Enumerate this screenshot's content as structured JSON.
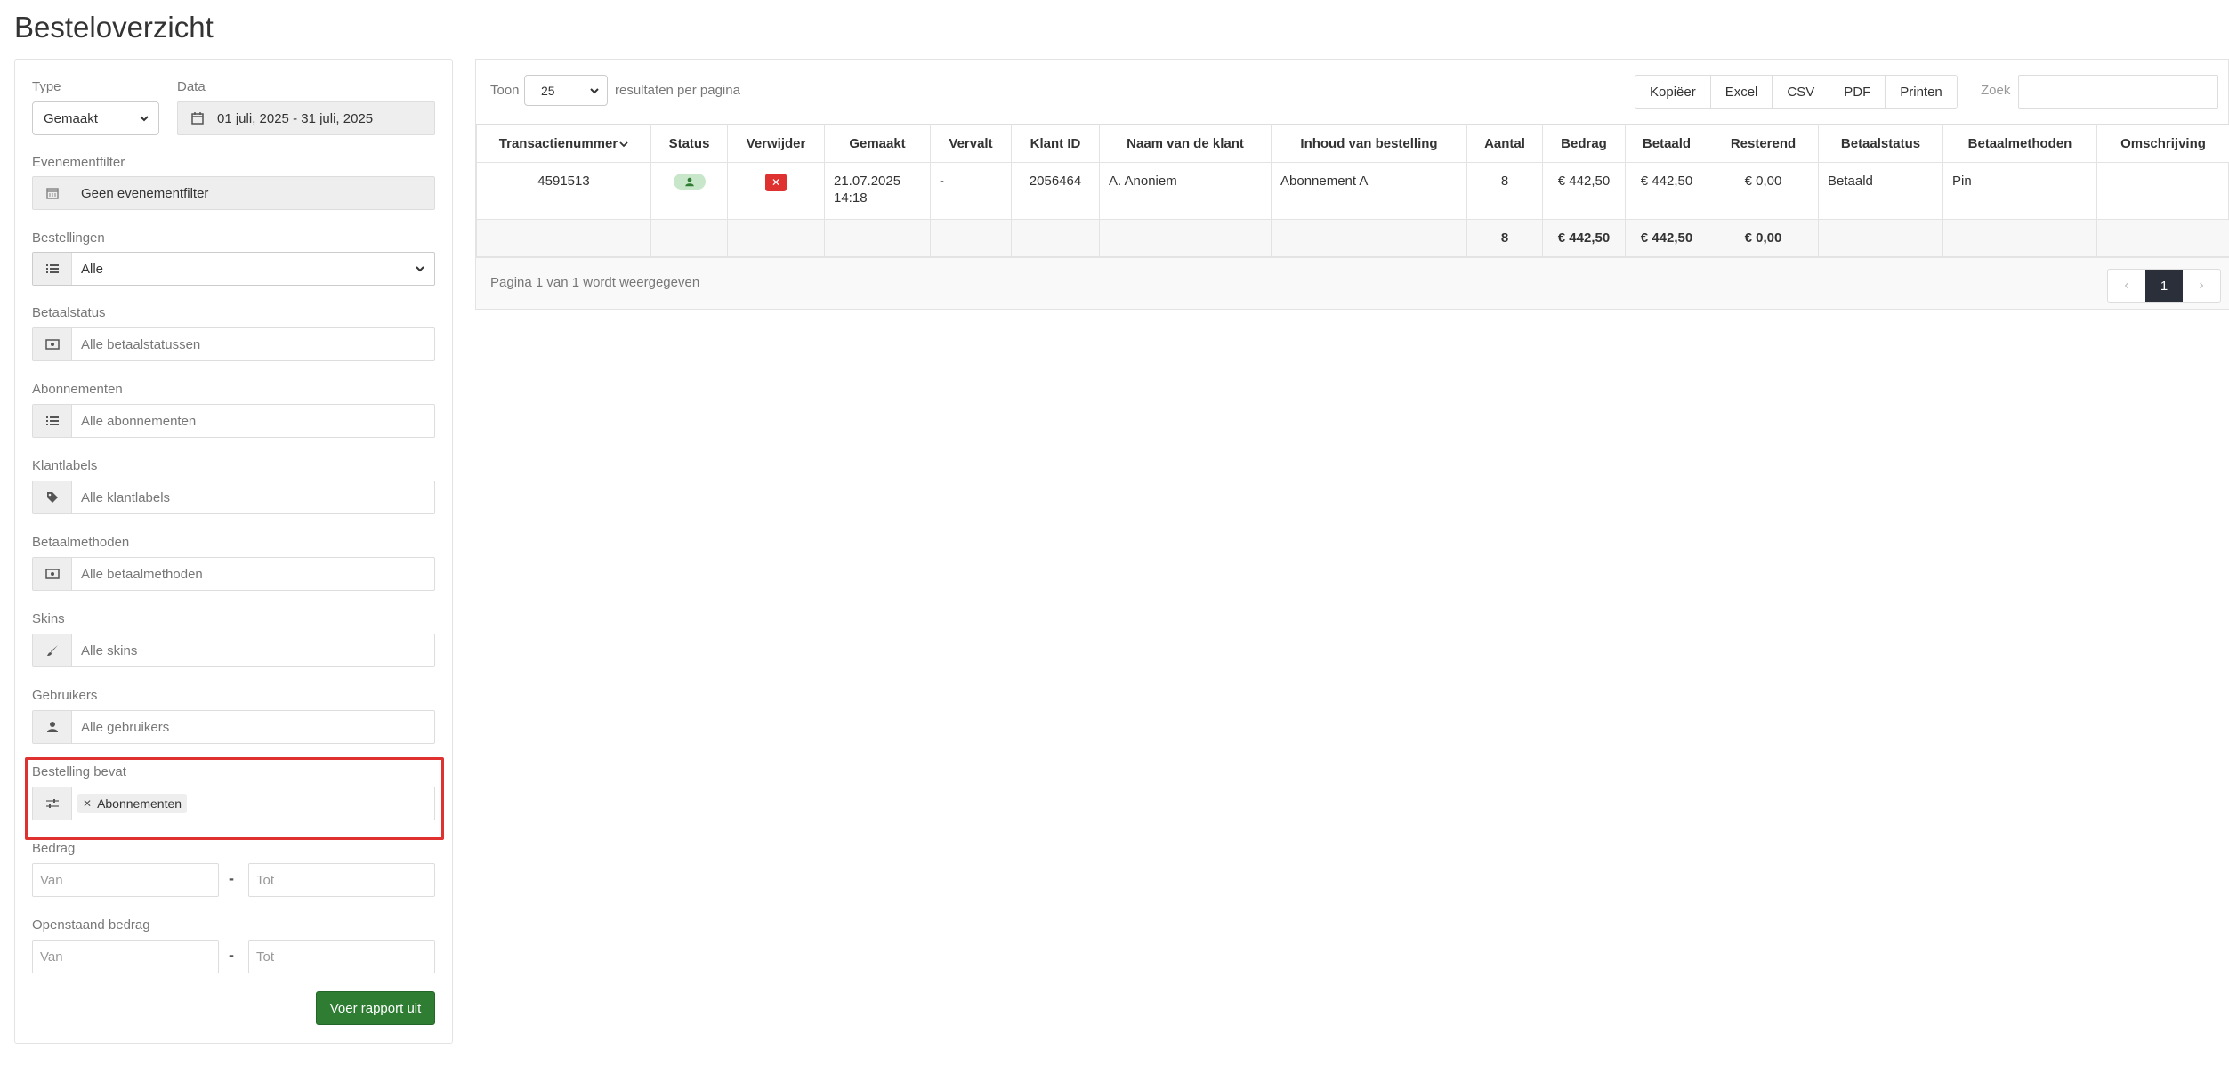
{
  "page": {
    "title": "Besteloverzicht"
  },
  "filters": {
    "type_label": "Type",
    "type_value": "Gemaakt",
    "data_label": "Data",
    "date_range": "01 juli, 2025 - 31 juli, 2025",
    "event_label": "Evenementfilter",
    "event_value": "Geen evenementfilter",
    "orders_label": "Bestellingen",
    "orders_value": "Alle",
    "paystatus_label": "Betaalstatus",
    "paystatus_placeholder": "Alle betaalstatussen",
    "subscriptions_label": "Abonnementen",
    "subscriptions_placeholder": "Alle abonnementen",
    "customer_labels_label": "Klantlabels",
    "customer_labels_placeholder": "Alle klantlabels",
    "paymethods_label": "Betaalmethoden",
    "paymethods_placeholder": "Alle betaalmethoden",
    "skins_label": "Skins",
    "skins_placeholder": "Alle skins",
    "users_label": "Gebruikers",
    "users_placeholder": "Alle gebruikers",
    "order_contains_label": "Bestelling bevat",
    "order_contains_tag": "Abonnementen",
    "amount_label": "Bedrag",
    "outstanding_label": "Openstaand bedrag",
    "from_placeholder": "Van",
    "to_placeholder": "Tot",
    "dash": "-",
    "run_button": "Voer rapport uit"
  },
  "toolbar": {
    "show_label": "Toon",
    "page_size": "25",
    "per_page_label": "resultaten per pagina",
    "export_buttons": [
      "Kopiëer",
      "Excel",
      "CSV",
      "PDF",
      "Printen"
    ],
    "search_label": "Zoek"
  },
  "table": {
    "headers": [
      "Transactienummer",
      "Status",
      "Verwijder",
      "Gemaakt",
      "Vervalt",
      "Klant ID",
      "Naam van de klant",
      "Inhoud van bestelling",
      "Aantal",
      "Bedrag",
      "Betaald",
      "Resterend",
      "Betaalstatus",
      "Betaalmethoden",
      "Omschrijving"
    ],
    "row": {
      "transaction": "4591513",
      "created_date": "21.07.2025",
      "created_time": "14:18",
      "expires": "-",
      "customer_id": "2056464",
      "customer_name": "A. Anoniem",
      "order_content": "Abonnement A",
      "count": "8",
      "amount": "€ 442,50",
      "paid": "€ 442,50",
      "remaining": "€ 0,00",
      "pay_status": "Betaald",
      "pay_method": "Pin",
      "description": ""
    },
    "totals": {
      "count": "8",
      "amount": "€ 442,50",
      "paid": "€ 442,50",
      "remaining": "€ 0,00"
    }
  },
  "footer": {
    "page_info": "Pagina 1 van 1 wordt weergegeven",
    "prev": "‹",
    "current_page": "1",
    "next": "›"
  },
  "colors": {
    "run_button": "#2e7d32",
    "highlight": "#e03131",
    "status_pill": "#c8e6c9",
    "delete": "#e03131",
    "pager_active": "#2b2f3a"
  }
}
